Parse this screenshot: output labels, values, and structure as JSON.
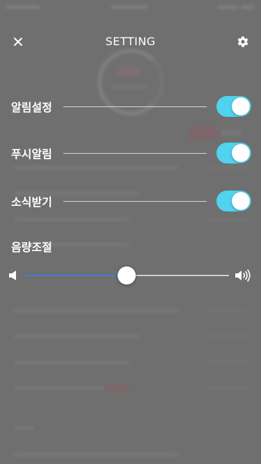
{
  "header": {
    "title": "SETTING",
    "close_icon": "close-icon",
    "settings_icon": "gear-icon"
  },
  "settings": [
    {
      "label": "알림설정",
      "enabled": true
    },
    {
      "label": "푸시알림",
      "enabled": true
    },
    {
      "label": "소식받기",
      "enabled": true
    }
  ],
  "volume": {
    "label": "음량조절",
    "level": 0.5,
    "min_icon": "speaker-mute-icon",
    "max_icon": "speaker-loud-icon"
  },
  "colors": {
    "toggle_on": "#4fd3ee",
    "slider_fill": "#3e7fd4",
    "overlay": "#6f6f6f"
  }
}
